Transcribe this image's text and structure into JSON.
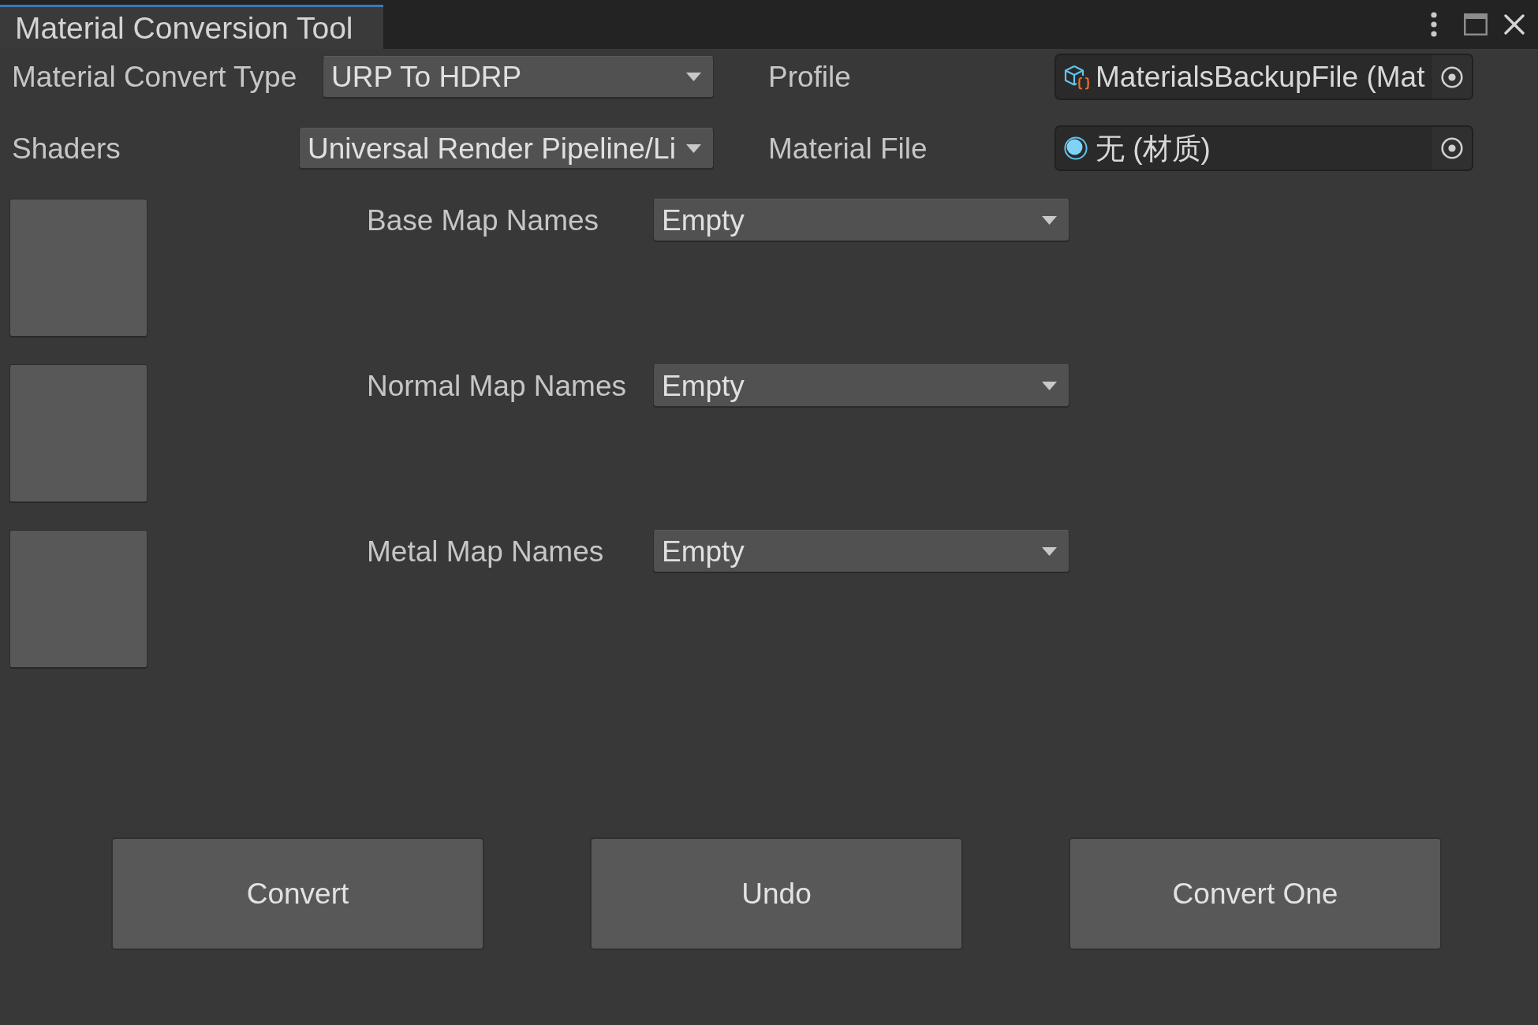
{
  "window": {
    "tabs": [
      {
        "label": "Material Conversion Tool",
        "selected": true
      }
    ]
  },
  "convert_type": {
    "label": "Material Convert Type",
    "value": "URP To HDRP"
  },
  "profile": {
    "label": "Profile",
    "value": "MaterialsBackupFile (Mat"
  },
  "shaders": {
    "label": "Shaders",
    "value": "Universal Render Pipeline/Li"
  },
  "material_file": {
    "label": "Material File",
    "value": "无 (材质)"
  },
  "map_slots": [
    {
      "label": "Base Map Names",
      "value": "Empty"
    },
    {
      "label": "Normal Map Names",
      "value": "Empty"
    },
    {
      "label": "Metal Map Names",
      "value": "Empty"
    }
  ],
  "buttons": [
    "Convert",
    "Undo",
    "Convert One"
  ]
}
